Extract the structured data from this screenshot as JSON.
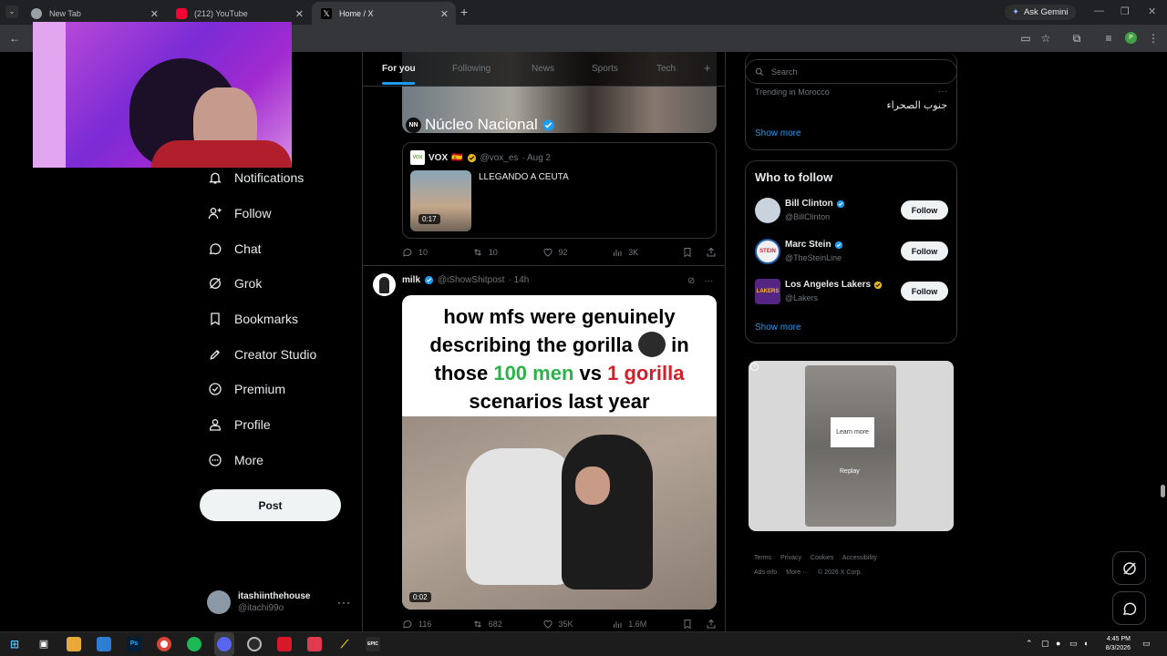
{
  "browser": {
    "tabs": [
      {
        "title": "New Tab"
      },
      {
        "title": "(212) YouTube"
      },
      {
        "title": "Home / X"
      }
    ],
    "new_tab_icon": "plus-icon",
    "ask_gemini": "Ask Gemini",
    "profile_initial": "P"
  },
  "nav": {
    "items": [
      {
        "label": "Notifications",
        "icon": "bell-icon"
      },
      {
        "label": "Follow",
        "icon": "person-plus-icon"
      },
      {
        "label": "Chat",
        "icon": "chat-icon"
      },
      {
        "label": "Grok",
        "icon": "grok-icon"
      },
      {
        "label": "Bookmarks",
        "icon": "bookmark-icon"
      },
      {
        "label": "Creator Studio",
        "icon": "rocket-icon"
      },
      {
        "label": "Premium",
        "icon": "verified-icon"
      },
      {
        "label": "Profile",
        "icon": "person-icon"
      },
      {
        "label": "More",
        "icon": "more-circle-icon"
      }
    ],
    "post_label": "Post",
    "account": {
      "name": "itashiinthehouse",
      "handle": "@itachi99o"
    }
  },
  "feed": {
    "tabs": [
      "For you",
      "Following",
      "News",
      "Sports",
      "Tech"
    ],
    "post1": {
      "media_caption": "Núcleo Nacional",
      "quote": {
        "author": "VOX",
        "flag": "🇪🇸",
        "handle": "@vox_es",
        "date": "· Aug 2",
        "text": "LLEGANDO A CEUTA",
        "duration": "0:17"
      },
      "stats": {
        "replies": "10",
        "reposts": "10",
        "likes": "92",
        "views": "3K"
      }
    },
    "post2": {
      "author": "milk",
      "handle": "@iShowShitpost",
      "time": "· 14h",
      "meme_line1": "how mfs were genuinely",
      "meme_line2a": "describing the gorilla",
      "meme_line2b": "in",
      "meme_line3a": "those",
      "meme_line3b": "100 men",
      "meme_line3c": "vs",
      "meme_line3d": "1 gorilla",
      "meme_line4": "scenarios last year",
      "duration": "0:02",
      "stats": {
        "replies": "116",
        "reposts": "682",
        "likes": "35K",
        "views": "1.6M"
      }
    }
  },
  "sidebar": {
    "search_placeholder": "Search",
    "trend": {
      "meta": "Trending in Morocco",
      "name": "جنوب الصحراء"
    },
    "show_more": "Show more",
    "who_to_follow": {
      "title": "Who to follow",
      "people": [
        {
          "name": "Bill Clinton",
          "handle": "@BillClinton",
          "verified": "blue",
          "avatar_color": "#c9d3de"
        },
        {
          "name": "Marc Stein",
          "handle": "@TheSteinLine",
          "verified": "blue",
          "avatar_color": "#f0f0f0"
        },
        {
          "name": "Los Angeles Lakers",
          "handle": "@Lakers",
          "verified": "gold",
          "avatar_color": "#552583"
        }
      ],
      "follow_label": "Follow",
      "show_more": "Show more"
    },
    "ad": {
      "learn_more": "Learn more",
      "replay": "Replay"
    },
    "footer": {
      "links": [
        "Terms",
        "Privacy",
        "Cookies",
        "Accessibility",
        "Ads info",
        "More ···"
      ],
      "copyright": "© 2026 X Corp."
    }
  },
  "taskbar": {
    "time": "4:45 PM",
    "date": "8/3/2026",
    "apps": [
      "Ps",
      "EPIC"
    ]
  },
  "colors": {
    "accent": "#1d9bf0",
    "background": "#000000",
    "verified_gold": "#e2b719"
  }
}
